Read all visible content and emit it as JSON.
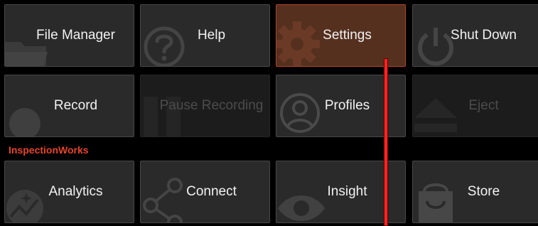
{
  "tiles_row1": [
    {
      "label": "File Manager",
      "icon": "folder-icon"
    },
    {
      "label": "Help",
      "icon": "question-icon"
    },
    {
      "label": "Settings",
      "icon": "gear-icon"
    },
    {
      "label": "Shut Down",
      "icon": "power-icon"
    }
  ],
  "tiles_row2": [
    {
      "label": "Record",
      "icon": "record-icon"
    },
    {
      "label": "Pause Recording",
      "icon": "pause-icon",
      "state": "disabled"
    },
    {
      "label": "Profiles",
      "icon": "user-icon"
    },
    {
      "label": "Eject",
      "icon": "eject-icon",
      "state": "disabled"
    }
  ],
  "section": {
    "title": "InspectionWorks"
  },
  "tiles_row3": [
    {
      "label": "Analytics",
      "icon": "analytics-icon"
    },
    {
      "label": "Connect",
      "icon": "share-icon"
    },
    {
      "label": "Insight",
      "icon": "eye-icon"
    },
    {
      "label": "Store",
      "icon": "shopping-bag-icon"
    }
  ],
  "colors": {
    "background": "#000000",
    "tile": "#2a2a2a",
    "tile_active": "#55301f",
    "accent": "#e8452a",
    "pointer": "#ff2424"
  }
}
